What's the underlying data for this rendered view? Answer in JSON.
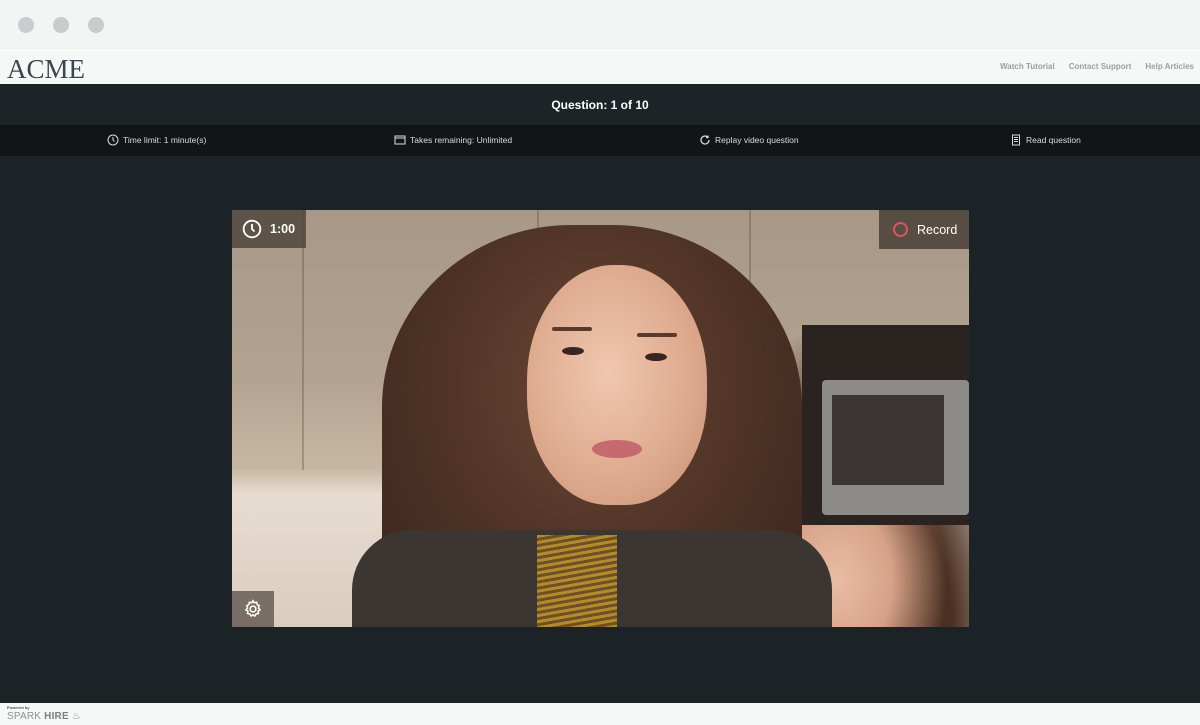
{
  "window": {
    "controls": [
      "close",
      "minimize",
      "maximize"
    ]
  },
  "header": {
    "logo": "ACME",
    "links": [
      "Watch Tutorial",
      "Contact Support",
      "Help Articles"
    ]
  },
  "question_bar": {
    "title": "Question: 1 of 10"
  },
  "info_bar": {
    "items": [
      {
        "icon": "clock-icon",
        "label": "Time limit: 1 minute(s)"
      },
      {
        "icon": "window-icon",
        "label": "Takes remaining: Unlimited"
      },
      {
        "icon": "replay-icon",
        "label": "Replay video question"
      },
      {
        "icon": "document-icon",
        "label": "Read question"
      }
    ]
  },
  "video": {
    "timer": "1:00",
    "record_label": "Record",
    "record_color": "#e0555b",
    "settings_icon": "gear-icon"
  },
  "footer": {
    "powered_by": "Powered by",
    "brand_light": "SPARK",
    "brand_bold": "HIRE"
  }
}
